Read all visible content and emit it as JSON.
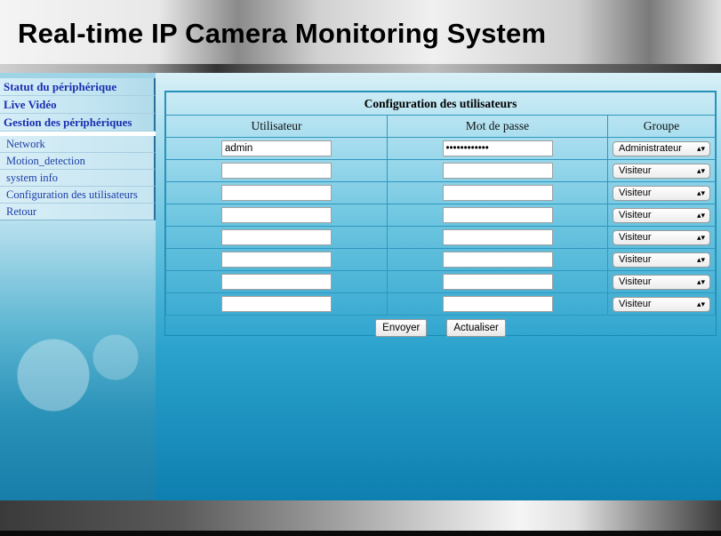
{
  "header": {
    "title": "Real-time IP Camera Monitoring System"
  },
  "nav": {
    "main": [
      {
        "label": "Statut du périphérique"
      },
      {
        "label": "Live Vidéo"
      },
      {
        "label": "Gestion des périphériques"
      }
    ],
    "sub": [
      {
        "label": "Network"
      },
      {
        "label": "Motion_detection"
      },
      {
        "label": "system info"
      },
      {
        "label": "Configuration des utilisateurs"
      },
      {
        "label": "Retour"
      }
    ]
  },
  "users_panel": {
    "caption": "Configuration des utilisateurs",
    "columns": [
      "Utilisateur",
      "Mot de passe",
      "Groupe"
    ],
    "rows": [
      {
        "user": "admin",
        "password": "••••••••••••",
        "group": "Administrateur"
      },
      {
        "user": "",
        "password": "",
        "group": "Visiteur"
      },
      {
        "user": "",
        "password": "",
        "group": "Visiteur"
      },
      {
        "user": "",
        "password": "",
        "group": "Visiteur"
      },
      {
        "user": "",
        "password": "",
        "group": "Visiteur"
      },
      {
        "user": "",
        "password": "",
        "group": "Visiteur"
      },
      {
        "user": "",
        "password": "",
        "group": "Visiteur"
      },
      {
        "user": "",
        "password": "",
        "group": "Visiteur"
      }
    ],
    "submit_label": "Envoyer",
    "refresh_label": "Actualiser"
  },
  "colors": {
    "nav_link": "#1a2fb0",
    "panel_border": "#2f97bf"
  }
}
